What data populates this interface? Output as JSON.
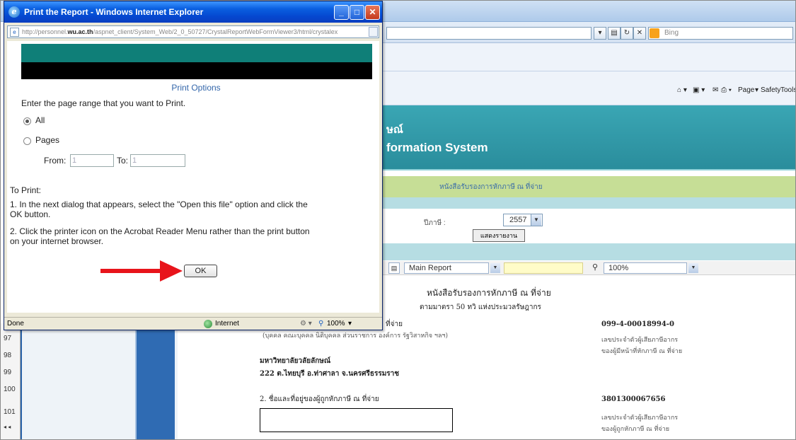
{
  "background_browser": {
    "search_placeholder": "Bing",
    "command_bar": {
      "page_label": "Page",
      "safety_label": "Safety",
      "tools_label": "Tools"
    },
    "banner": {
      "title_fragment": "ษณ์",
      "subtitle_fragment": "formation System"
    },
    "section_title": "หนังสือรับรองการหักภาษี ณ ที่จ่าย",
    "year_label": "ปีภาษี :",
    "year_value": "2557",
    "show_button_label": "แสดงรายงาน",
    "report_toolbar": {
      "report_select_value": "Main Report",
      "zoom_value": "100%"
    },
    "line_numbers": [
      "97",
      "98",
      "99",
      "100",
      "101"
    ],
    "document": {
      "title_line1": "หนังสือรับรองการหักภาษี ณ ที่จ่าย",
      "title_line2": "ตามมาตรา 50 ทวิ แห่งประมวลรัษฎากร",
      "payer_heading_fragment": "ที่จ่าย",
      "payer_note": "(บุคคล คณะบุคคล นิติบุคคล ส่วนราชการ องค์การ รัฐวิสาหกิจ ฯลฯ)",
      "payer_tax_id": "099-4-00018994-0",
      "payer_tax_id_caption1": "เลขประจำตัวผู้เสียภาษีอากร",
      "payer_tax_id_caption2": "ของผู้มีหน้าที่หักภาษี ณ ที่จ่าย",
      "payer_name": "มหาวิทยาลัยวลัยลักษณ์",
      "payer_address": "222 ต.ไทยบุรี อ.ท่าศาลา จ.นครศรีธรรมราช",
      "payee_heading": "2. ชื่อและที่อยู่ของผู้ถูกหักภาษี ณ ที่จ่าย",
      "payee_tax_id": "3801300067656",
      "payee_tax_id_caption1": "เลขประจำตัวผู้เสียภาษีอากร",
      "payee_tax_id_caption2": "ของผู้ถูกหักภาษี ณ ที่จ่าย"
    }
  },
  "popup": {
    "title": "Print the Report - Windows Internet Explorer",
    "address_prefix": "http://personnel.",
    "address_host": "wu.ac.th",
    "address_rest": "/aspnet_client/System_Web/2_0_50727/CrystalReportWebFormViewer3/html/crystalex",
    "print_options_heading": "Print Options",
    "instruction": "Enter the page range that you want to Print.",
    "option_all": "All",
    "option_pages": "Pages",
    "from_label": "From:",
    "from_value": "1",
    "to_label": "To:",
    "to_value": "1",
    "to_print_heading": "To Print:",
    "step1_line1": "1. In the next dialog that appears, select the \"Open this file\" option and click the",
    "step1_line2": "OK button.",
    "step2_line1": "2. Click the printer icon on the Acrobat Reader Menu rather than the print button",
    "step2_line2": "on your internet browser.",
    "ok_label": "OK",
    "status": {
      "left": "Done",
      "zone": "Internet",
      "zoom": "100%"
    }
  },
  "colors": {
    "accent_arrow": "#e8141b",
    "banner_teal": "#2a8d9c",
    "popup_title_blue": "#0548d0"
  }
}
